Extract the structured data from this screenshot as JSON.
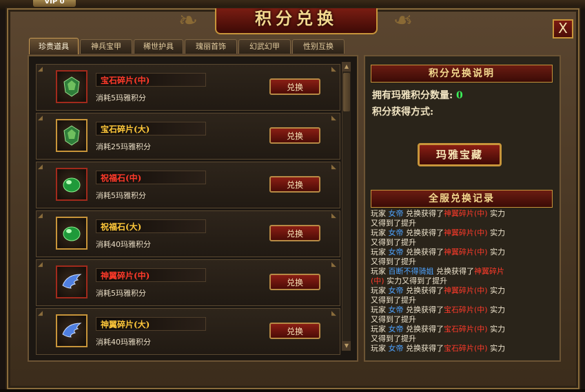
{
  "window": {
    "title": "积分兑换",
    "close_label": "X",
    "vip_label": "VIP 0"
  },
  "tabs": [
    {
      "label": "珍贵道具",
      "active": true
    },
    {
      "label": "神兵宝甲",
      "active": false
    },
    {
      "label": "稀世护具",
      "active": false
    },
    {
      "label": "瑰丽首饰",
      "active": false
    },
    {
      "label": "幻武幻甲",
      "active": false
    },
    {
      "label": "性别互换",
      "active": false
    }
  ],
  "items": [
    {
      "name": "宝石碎片(中)",
      "name_color": "#ff3a2a",
      "cost": "消耗5玛雅积分",
      "icon": "gem-fragment-icon",
      "border": "red",
      "button": "兑换"
    },
    {
      "name": "宝石碎片(大)",
      "name_color": "#ffc83a",
      "cost": "消耗25玛雅积分",
      "icon": "gem-fragment-icon",
      "border": "gold",
      "button": "兑换"
    },
    {
      "name": "祝福石(中)",
      "name_color": "#ff3a2a",
      "cost": "消耗5玛雅积分",
      "icon": "blessing-stone-icon",
      "border": "red",
      "button": "兑换"
    },
    {
      "name": "祝福石(大)",
      "name_color": "#ffc83a",
      "cost": "消耗40玛雅积分",
      "icon": "blessing-stone-icon",
      "border": "gold",
      "button": "兑换"
    },
    {
      "name": "神翼碎片(中)",
      "name_color": "#ff3a2a",
      "cost": "消耗5玛雅积分",
      "icon": "wing-fragment-icon",
      "border": "red",
      "button": "兑换"
    },
    {
      "name": "神翼碎片(大)",
      "name_color": "#ffc83a",
      "cost": "消耗40玛雅积分",
      "icon": "wing-fragment-icon",
      "border": "gold",
      "button": "兑换"
    }
  ],
  "info": {
    "header": "积分兑换说明",
    "points_label": "拥有玛雅积分数量:",
    "points_value": "0",
    "method_label": "积分获得方式:",
    "treasure_button": "玛雅宝藏"
  },
  "log": {
    "header": "全服兑换记录",
    "lines": [
      [
        [
          "玩家 ",
          "n"
        ],
        [
          "女帝",
          "name"
        ],
        [
          " 兑换获得了",
          "n"
        ],
        [
          "神翼碎片(中)",
          "item"
        ],
        [
          " 实力",
          "n"
        ]
      ],
      [
        [
          "又得到了提升",
          "n"
        ]
      ],
      [
        [
          "玩家 ",
          "n"
        ],
        [
          "女帝",
          "name"
        ],
        [
          " 兑换获得了",
          "n"
        ],
        [
          "神翼碎片(中)",
          "item"
        ],
        [
          " 实力",
          "n"
        ]
      ],
      [
        [
          "又得到了提升",
          "n"
        ]
      ],
      [
        [
          "玩家 ",
          "n"
        ],
        [
          "女帝",
          "name"
        ],
        [
          " 兑换获得了",
          "n"
        ],
        [
          "神翼碎片(中)",
          "item"
        ],
        [
          " 实力",
          "n"
        ]
      ],
      [
        [
          "又得到了提升",
          "n"
        ]
      ],
      [
        [
          "玩家 ",
          "n"
        ],
        [
          "百断不得骑姐",
          "name"
        ],
        [
          " 兑换获得了",
          "n"
        ],
        [
          "神翼碎片",
          "item"
        ]
      ],
      [
        [
          "(中)",
          "item"
        ],
        [
          " 实力又得到了提升",
          "n"
        ]
      ],
      [
        [
          "玩家 ",
          "n"
        ],
        [
          "女帝",
          "name"
        ],
        [
          " 兑换获得了",
          "n"
        ],
        [
          "神翼碎片(中)",
          "item"
        ],
        [
          " 实力",
          "n"
        ]
      ],
      [
        [
          "又得到了提升",
          "n"
        ]
      ],
      [
        [
          "玩家 ",
          "n"
        ],
        [
          "女帝",
          "name"
        ],
        [
          " 兑换获得了",
          "n"
        ],
        [
          "宝石碎片(中)",
          "item"
        ],
        [
          " 实力",
          "n"
        ]
      ],
      [
        [
          "又得到了提升",
          "n"
        ]
      ],
      [
        [
          "玩家 ",
          "n"
        ],
        [
          "女帝",
          "name"
        ],
        [
          " 兑换获得了",
          "n"
        ],
        [
          "宝石碎片(中)",
          "item"
        ],
        [
          " 实力",
          "n"
        ]
      ],
      [
        [
          "又得到了提升",
          "n"
        ]
      ],
      [
        [
          "玩家 ",
          "n"
        ],
        [
          "女帝",
          "name"
        ],
        [
          " 兑换获得了",
          "n"
        ],
        [
          "宝石碎片(中)",
          "item"
        ],
        [
          " 实力",
          "n"
        ]
      ]
    ]
  }
}
